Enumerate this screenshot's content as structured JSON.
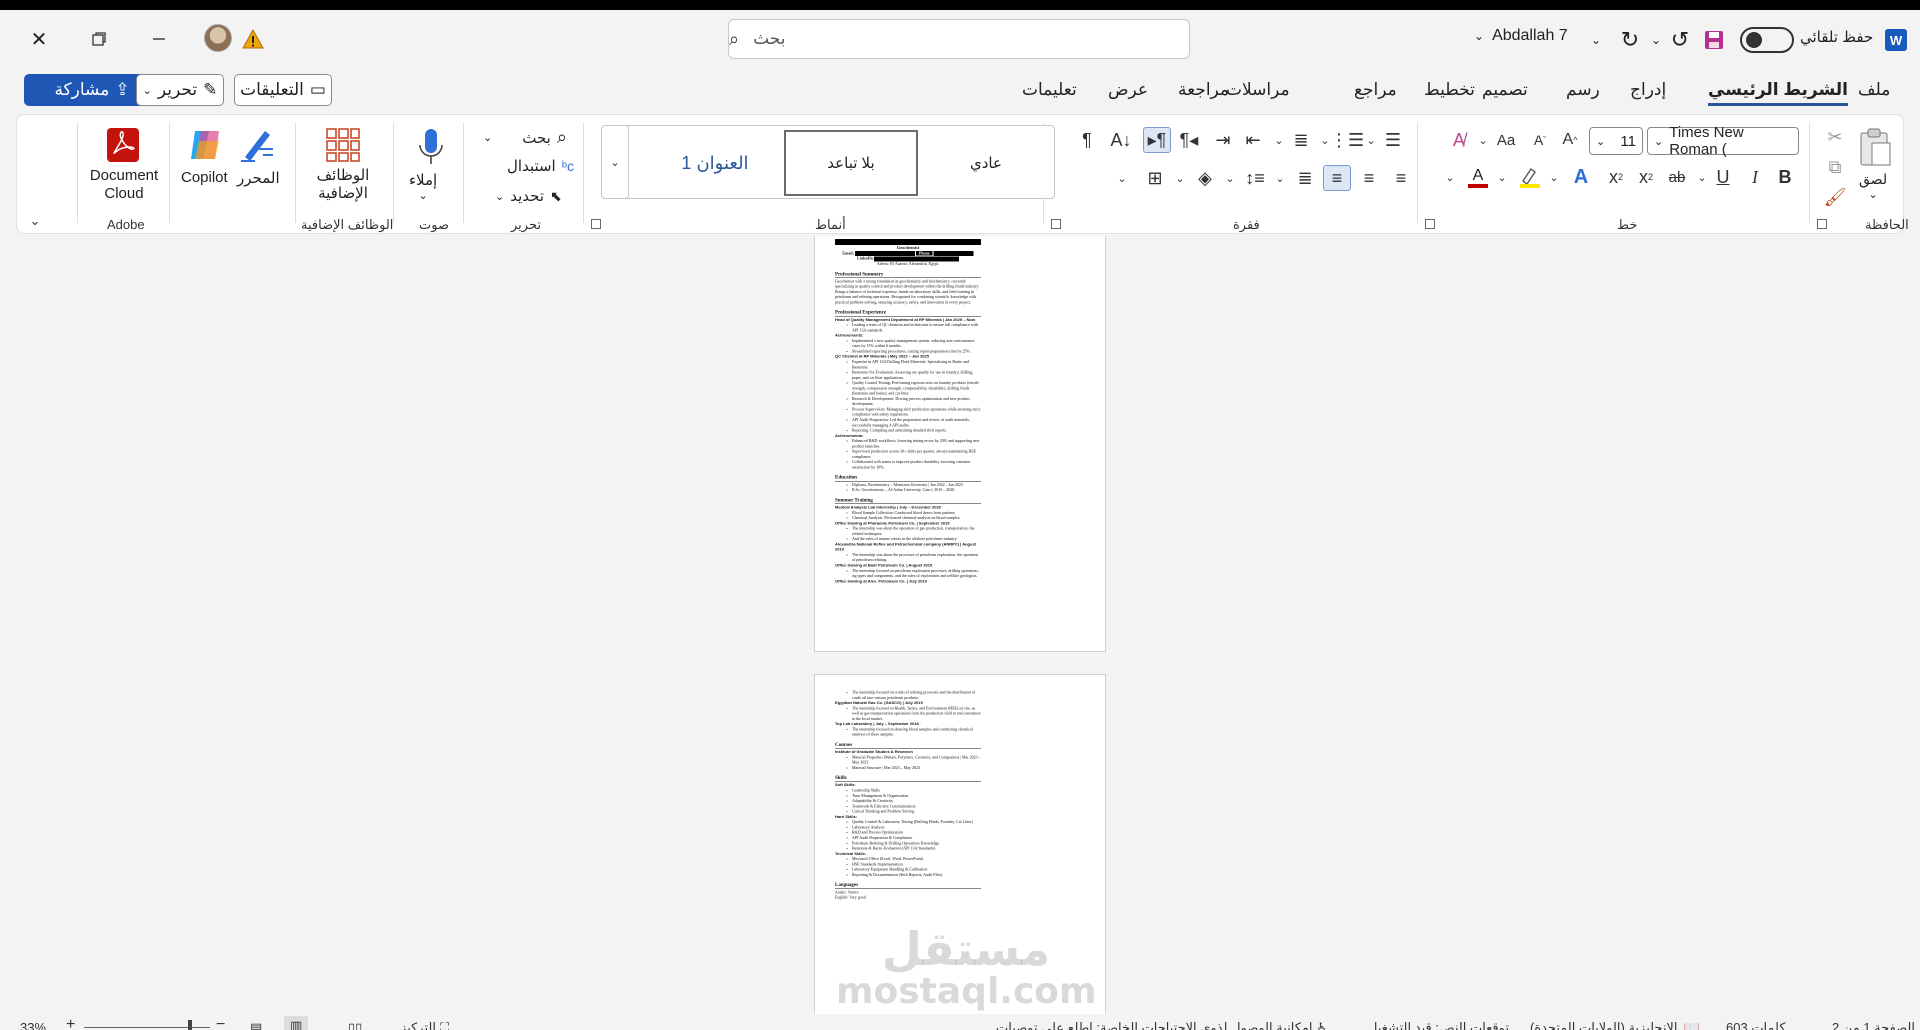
{
  "titlebar": {
    "autosave_label": "حفظ تلقائي",
    "user_name": "Abdallah 7",
    "search_placeholder": "بحث"
  },
  "tabs": [
    "ملف",
    "الشريط الرئيسي",
    "إدراج",
    "رسم",
    "تصميم",
    "تخطيط",
    "مراجع",
    "مراسلات",
    "مراجعة",
    "عرض",
    "تعليمات"
  ],
  "actions": {
    "comments": "التعليقات",
    "edit": "تحرير",
    "share": "مشاركة"
  },
  "ribbon": {
    "clipboard": {
      "label": "الحافظة",
      "paste": "لصق"
    },
    "font": {
      "label": "خط",
      "name": "Times New Roman (",
      "size": "11"
    },
    "paragraph": {
      "label": "فقرة"
    },
    "styles": {
      "label": "أنماط",
      "items": [
        "عادي",
        "بلا تباعد",
        "العنوان 1"
      ]
    },
    "editing": {
      "label": "تحرير",
      "find": "بحث",
      "replace": "استبدال",
      "select": "تحديد"
    },
    "voice": {
      "label": "صوت",
      "dictate": "إملاء"
    },
    "addins": {
      "label": "الوظائف الإضافية",
      "button": "الوظائف الإضافية"
    },
    "editor": "المحرر",
    "copilot": "Copilot",
    "adobe": {
      "label": "Adobe",
      "button": "Document Cloud"
    }
  },
  "document": {
    "page1": {
      "name": "Geochemist",
      "email_label": "Email:",
      "phone_label": "Phone",
      "linkedin_label": "LinkedIn",
      "adress": "Adress: El-Aaamri, Alexandria, Egypt.",
      "summary_title": "Professional Summary",
      "summary_text": "Geochemist with a strong foundation in geochemistry and biochemistry, currently specializing in quality control and product development within the drilling fluids industry. Brings a balance of technical expertise, hands-on laboratory skills, and field training in petroleum and refining operations. Recognized for combining scientific knowledge with practical problem-solving, ensuring accuracy, safety, and innovation in every project.",
      "experience_title": "Professional Experience",
      "job1": "Head of Quality Management Department at RP Minerals | Jan 2025 – Now",
      "job1_items": [
        "Leading a team of QC chemists and technicians to ensure full compliance with API 13A standards."
      ],
      "achievements": "Achievements:",
      "job1_ach": [
        "Implemented a new quality management system, reducing non-conformance cases by 15% within 6 months.",
        "Streamlined reporting procedures, cutting report preparation time by 25%."
      ],
      "job2": "QC Chemist at RP Minerals | May 2022 – Jan 2025",
      "job2_items": [
        "Expertise in API 13A Drilling Fluid Materials: Specializing in Barite and Bentonite.",
        "Bentonite Ore Evaluation: Assessing ore quality for use in foundry, drilling, paper, and cat litter applications.",
        "Quality Control Testing: Performing rigorous tests on foundry products (tensile strength, compression strength, compactability, durability), drilling fluids (bentonite and barite), and cat litter.",
        "Research & Development: Driving process optimization and new product development.",
        "Process Supervision: Managing shift production operations while ensuring strict compliance with safety regulations.",
        "API Audit Preparation: Led the preparation and review of audit materials, successfully managing 4 API audits.",
        "Reporting: Compiling and submitting detailed shift reports."
      ],
      "job2_ach": [
        "Enhanced R&D workflows, lowering testing errors by 20% and supporting new product launches.",
        "Supervised production across 30+ shifts per quarter, always maintaining HSE compliance.",
        "Collaborated with teams to improve product durability, boosting customer satisfaction by 10%."
      ],
      "education_title": "Education",
      "education": [
        "Diploma, Biochemistry – Mansoura University | Jan 2022 – Jan 2023",
        "B.Sc. Geochemistry – Al-Azhar University, Cairo | 2016 – 2020."
      ],
      "training_title": "Summer Training",
      "training": [
        {
          "title": "Medical Analysis Lab Internship | July – December 2020",
          "items": [
            "Blood Sample Collection: Conducted blood draws from patients.",
            "Chemical Analysis: Performed chemical analysis on blood samples."
          ]
        },
        {
          "title": "Office training at Pharaonic Petroleum Co. | September 2019",
          "items": [
            "The internship was about the operation of gas production, transportation, the refined techniques.",
            "And the roles of marine robots in the offshore petroleum industry."
          ]
        },
        {
          "title": "Alexandria National Refine and Petrochemical company (ANRPC) | August 2019",
          "items": [
            "The internship was about the processes of petroleum exploration, the operation of petroleum refining."
          ]
        },
        {
          "title": "Office training at Badr Petroleum Co. | August 2019",
          "items": [
            "The internship focused on petroleum exploration processes, drilling operations, rig types and components, and the roles of exploration and wellsite geologists."
          ]
        },
        {
          "title": "Office training at Alex. Petroleum Co. | July 2019",
          "items": []
        }
      ]
    },
    "page2": {
      "top_item": "The internship focused on crude oil refining processes and the distribution of crude oil into various petroleum products.",
      "gasco": "Egyptian Natural Gas Co. (GASCO) | July 2019",
      "gasco_items": [
        "The internship focused on Health, Safety, and Environment (HSE) on site, as well as gas transportation operations from the production field to end consumers in the local market."
      ],
      "toplab": "Top Lab Laboratory | July – September 2018",
      "toplab_items": [
        "The internship focused on drawing blood samples and conducting chemical analyses of these samples."
      ],
      "courses_title": "Courses",
      "institute": "Institute of Graduate Studies & Research",
      "courses": [
        "Material Properties (Metals, Polymers, Ceramics, and Composites) | Mar 2023 – May 2023",
        "Material Structure | Mar 2023 – May 2023"
      ],
      "skills_title": "Skills",
      "soft_title": "Soft Skills:",
      "soft": [
        "Leadership Skills",
        "Time Management & Organization",
        "Adaptability & Creativity",
        "Teamwork & Effective Communication",
        "Critical Thinking and Problem Solving"
      ],
      "hard_title": "Hard Skills:",
      "hard": [
        "Quality Control & Laboratory Testing (Drilling Fluids, Foundry, Cat Litter)",
        "Laboratory Analysis",
        "R&D and Process Optimization",
        "API Audit Preparation & Compliance",
        "Petroleum Refining & Drilling Operations Knowledge",
        "Bentonite & Barite Evaluation (API 13A Standards)"
      ],
      "tech_title": "Technical Skills:",
      "tech": [
        "Microsoft Office (Excel, Word, PowerPoint)",
        "HSE Standards Implementation",
        "Laboratory Equipment Handling & Calibration",
        "Reporting & Documentation (Shift Reports, Audit Files)"
      ],
      "lang_title": "Languages",
      "languages": [
        "Arabic: Native",
        "English: Very good"
      ]
    },
    "watermark_ar": "مستقل",
    "watermark_en": "mostaql.com"
  },
  "statusbar": {
    "page": "الصفحة 1 من 2",
    "words": "603 كلمات",
    "language": "الإنجليزية (الولايات المتحدة)",
    "predictions": "توقعات النص: قيد التشغيل",
    "accessibility": "إمكانية الوصول لذوي الاحتياجات الخاصة: اطلع على توصيات",
    "focus": "التركيز",
    "zoom": "33%"
  }
}
